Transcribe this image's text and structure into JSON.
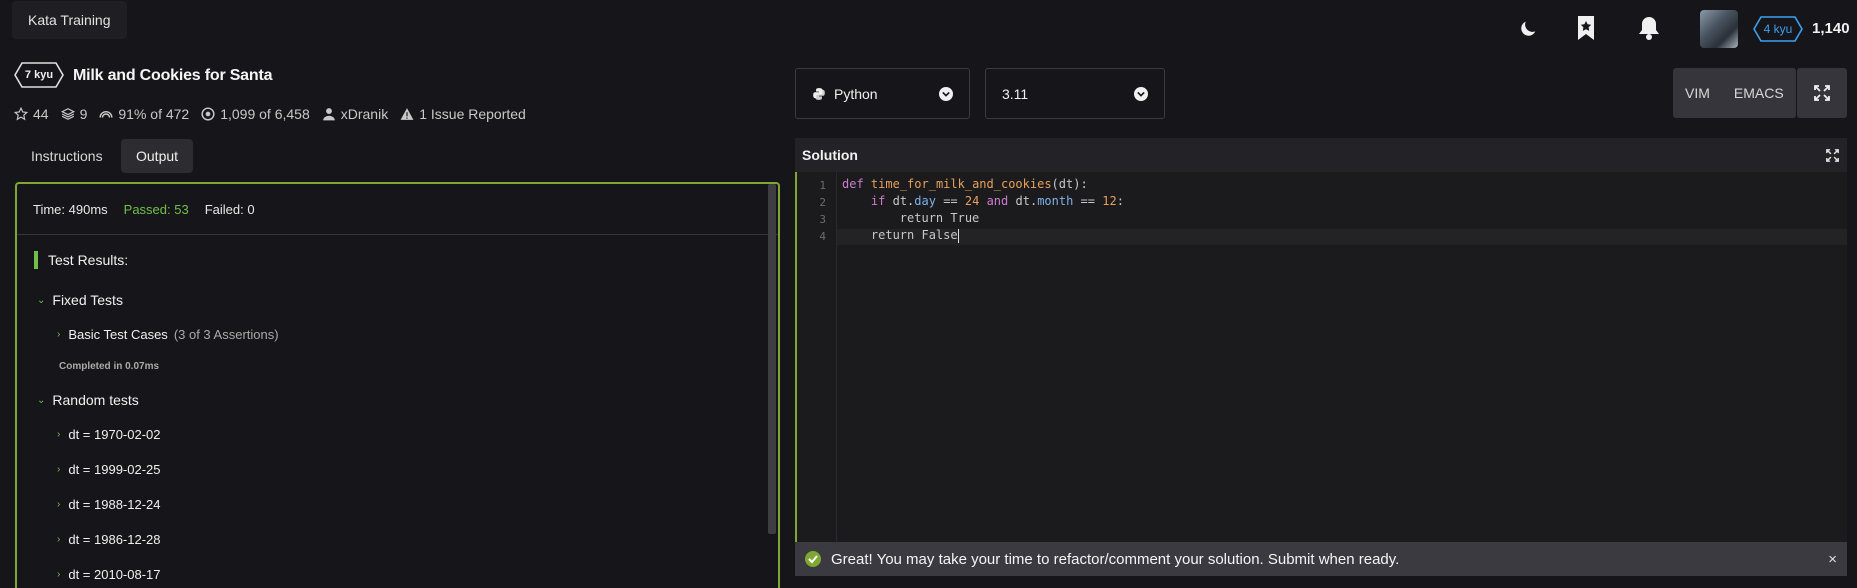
{
  "app": {
    "brand": "Kata Training"
  },
  "topbar": {
    "icons": [
      "moon-icon",
      "bookmark-star-icon",
      "bell-icon"
    ],
    "rank": "4 kyu",
    "honor": "1,140",
    "rank_color": "#3aa0f0"
  },
  "kata": {
    "kyu": "7 kyu",
    "title": "Milk and Cookies for Santa",
    "stats": {
      "stars": "44",
      "collections": "9",
      "satisfaction": "91% of 472",
      "completed": "1,099 of 6,458",
      "author": "xDranik",
      "issues": "1 Issue Reported"
    }
  },
  "tabs": {
    "instructions": "Instructions",
    "output": "Output"
  },
  "output": {
    "time": "Time: 490ms",
    "passed": "Passed: 53",
    "failed": "Failed: 0",
    "results_title": "Test Results:",
    "fixed_group": "Fixed Tests",
    "basic_case": "Basic Test Cases",
    "basic_assertions": "(3 of 3 Assertions)",
    "completed": "Completed in 0.07ms",
    "random_group": "Random tests",
    "random_items": [
      "dt = 1970-02-02",
      "dt = 1999-02-25",
      "dt = 1988-12-24",
      "dt = 1986-12-28",
      "dt = 2010-08-17"
    ]
  },
  "editor": {
    "language": "Python",
    "version": "3.11",
    "modes": [
      "VIM",
      "EMACS"
    ],
    "panel_title": "Solution",
    "line_numbers": [
      "1",
      "2",
      "3",
      "4"
    ],
    "code": {
      "l1_def": "def",
      "l1_fn": "time_for_milk_and_cookies",
      "l1_args": "(dt):",
      "l2_if": "if",
      "l2_dt1": "dt.",
      "l2_day": "day",
      "l2_eq1": "==",
      "l2_24": "24",
      "l2_and": "and",
      "l2_dt2": "dt.",
      "l2_month": "month",
      "l2_eq2": "==",
      "l2_12": "12",
      "l2_colon": ":",
      "l3": "return True",
      "l4": "return False"
    }
  },
  "notice": {
    "text": "Great! You may take your time to refactor/comment your solution. Submit when ready.",
    "close": "×"
  },
  "colors": {
    "accent_green": "#7fa733",
    "passed_green": "#6fc04a"
  }
}
